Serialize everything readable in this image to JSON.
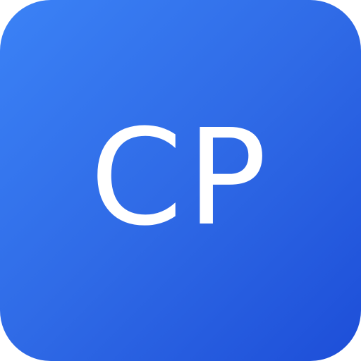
{
  "icon": {
    "label": "CP",
    "colors": {
      "gradient_start": "#3b82f6",
      "gradient_end": "#1d4ed8",
      "text": "#ffffff"
    }
  }
}
